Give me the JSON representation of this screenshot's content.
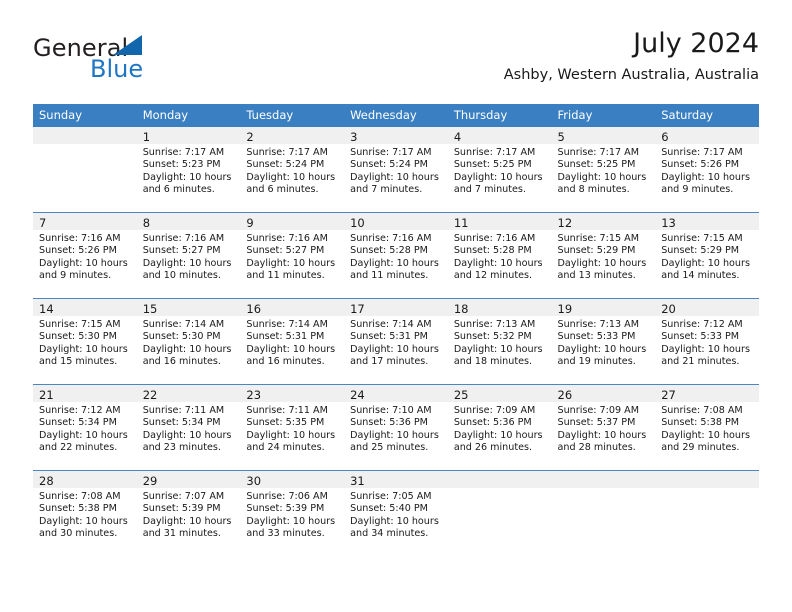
{
  "brand": {
    "name_part1": "General",
    "name_part2": "Blue",
    "logo_icon": "triangle-flag-icon"
  },
  "header": {
    "title": "July 2024",
    "location": "Ashby, Western Australia, Australia"
  },
  "calendar": {
    "weekday_headers": [
      "Sunday",
      "Monday",
      "Tuesday",
      "Wednesday",
      "Thursday",
      "Friday",
      "Saturday"
    ],
    "header_bg_color": "#3a7fc1",
    "daynum_bg_color": "#f0f0f0",
    "row_divider_color": "#4a86c5",
    "weeks": [
      [
        {
          "day": "",
          "sunrise": "",
          "sunset": "",
          "daylight1": "",
          "daylight2": ""
        },
        {
          "day": "1",
          "sunrise": "Sunrise: 7:17 AM",
          "sunset": "Sunset: 5:23 PM",
          "daylight1": "Daylight: 10 hours",
          "daylight2": "and 6 minutes."
        },
        {
          "day": "2",
          "sunrise": "Sunrise: 7:17 AM",
          "sunset": "Sunset: 5:24 PM",
          "daylight1": "Daylight: 10 hours",
          "daylight2": "and 6 minutes."
        },
        {
          "day": "3",
          "sunrise": "Sunrise: 7:17 AM",
          "sunset": "Sunset: 5:24 PM",
          "daylight1": "Daylight: 10 hours",
          "daylight2": "and 7 minutes."
        },
        {
          "day": "4",
          "sunrise": "Sunrise: 7:17 AM",
          "sunset": "Sunset: 5:25 PM",
          "daylight1": "Daylight: 10 hours",
          "daylight2": "and 7 minutes."
        },
        {
          "day": "5",
          "sunrise": "Sunrise: 7:17 AM",
          "sunset": "Sunset: 5:25 PM",
          "daylight1": "Daylight: 10 hours",
          "daylight2": "and 8 minutes."
        },
        {
          "day": "6",
          "sunrise": "Sunrise: 7:17 AM",
          "sunset": "Sunset: 5:26 PM",
          "daylight1": "Daylight: 10 hours",
          "daylight2": "and 9 minutes."
        }
      ],
      [
        {
          "day": "7",
          "sunrise": "Sunrise: 7:16 AM",
          "sunset": "Sunset: 5:26 PM",
          "daylight1": "Daylight: 10 hours",
          "daylight2": "and 9 minutes."
        },
        {
          "day": "8",
          "sunrise": "Sunrise: 7:16 AM",
          "sunset": "Sunset: 5:27 PM",
          "daylight1": "Daylight: 10 hours",
          "daylight2": "and 10 minutes."
        },
        {
          "day": "9",
          "sunrise": "Sunrise: 7:16 AM",
          "sunset": "Sunset: 5:27 PM",
          "daylight1": "Daylight: 10 hours",
          "daylight2": "and 11 minutes."
        },
        {
          "day": "10",
          "sunrise": "Sunrise: 7:16 AM",
          "sunset": "Sunset: 5:28 PM",
          "daylight1": "Daylight: 10 hours",
          "daylight2": "and 11 minutes."
        },
        {
          "day": "11",
          "sunrise": "Sunrise: 7:16 AM",
          "sunset": "Sunset: 5:28 PM",
          "daylight1": "Daylight: 10 hours",
          "daylight2": "and 12 minutes."
        },
        {
          "day": "12",
          "sunrise": "Sunrise: 7:15 AM",
          "sunset": "Sunset: 5:29 PM",
          "daylight1": "Daylight: 10 hours",
          "daylight2": "and 13 minutes."
        },
        {
          "day": "13",
          "sunrise": "Sunrise: 7:15 AM",
          "sunset": "Sunset: 5:29 PM",
          "daylight1": "Daylight: 10 hours",
          "daylight2": "and 14 minutes."
        }
      ],
      [
        {
          "day": "14",
          "sunrise": "Sunrise: 7:15 AM",
          "sunset": "Sunset: 5:30 PM",
          "daylight1": "Daylight: 10 hours",
          "daylight2": "and 15 minutes."
        },
        {
          "day": "15",
          "sunrise": "Sunrise: 7:14 AM",
          "sunset": "Sunset: 5:30 PM",
          "daylight1": "Daylight: 10 hours",
          "daylight2": "and 16 minutes."
        },
        {
          "day": "16",
          "sunrise": "Sunrise: 7:14 AM",
          "sunset": "Sunset: 5:31 PM",
          "daylight1": "Daylight: 10 hours",
          "daylight2": "and 16 minutes."
        },
        {
          "day": "17",
          "sunrise": "Sunrise: 7:14 AM",
          "sunset": "Sunset: 5:31 PM",
          "daylight1": "Daylight: 10 hours",
          "daylight2": "and 17 minutes."
        },
        {
          "day": "18",
          "sunrise": "Sunrise: 7:13 AM",
          "sunset": "Sunset: 5:32 PM",
          "daylight1": "Daylight: 10 hours",
          "daylight2": "and 18 minutes."
        },
        {
          "day": "19",
          "sunrise": "Sunrise: 7:13 AM",
          "sunset": "Sunset: 5:33 PM",
          "daylight1": "Daylight: 10 hours",
          "daylight2": "and 19 minutes."
        },
        {
          "day": "20",
          "sunrise": "Sunrise: 7:12 AM",
          "sunset": "Sunset: 5:33 PM",
          "daylight1": "Daylight: 10 hours",
          "daylight2": "and 21 minutes."
        }
      ],
      [
        {
          "day": "21",
          "sunrise": "Sunrise: 7:12 AM",
          "sunset": "Sunset: 5:34 PM",
          "daylight1": "Daylight: 10 hours",
          "daylight2": "and 22 minutes."
        },
        {
          "day": "22",
          "sunrise": "Sunrise: 7:11 AM",
          "sunset": "Sunset: 5:34 PM",
          "daylight1": "Daylight: 10 hours",
          "daylight2": "and 23 minutes."
        },
        {
          "day": "23",
          "sunrise": "Sunrise: 7:11 AM",
          "sunset": "Sunset: 5:35 PM",
          "daylight1": "Daylight: 10 hours",
          "daylight2": "and 24 minutes."
        },
        {
          "day": "24",
          "sunrise": "Sunrise: 7:10 AM",
          "sunset": "Sunset: 5:36 PM",
          "daylight1": "Daylight: 10 hours",
          "daylight2": "and 25 minutes."
        },
        {
          "day": "25",
          "sunrise": "Sunrise: 7:09 AM",
          "sunset": "Sunset: 5:36 PM",
          "daylight1": "Daylight: 10 hours",
          "daylight2": "and 26 minutes."
        },
        {
          "day": "26",
          "sunrise": "Sunrise: 7:09 AM",
          "sunset": "Sunset: 5:37 PM",
          "daylight1": "Daylight: 10 hours",
          "daylight2": "and 28 minutes."
        },
        {
          "day": "27",
          "sunrise": "Sunrise: 7:08 AM",
          "sunset": "Sunset: 5:38 PM",
          "daylight1": "Daylight: 10 hours",
          "daylight2": "and 29 minutes."
        }
      ],
      [
        {
          "day": "28",
          "sunrise": "Sunrise: 7:08 AM",
          "sunset": "Sunset: 5:38 PM",
          "daylight1": "Daylight: 10 hours",
          "daylight2": "and 30 minutes."
        },
        {
          "day": "29",
          "sunrise": "Sunrise: 7:07 AM",
          "sunset": "Sunset: 5:39 PM",
          "daylight1": "Daylight: 10 hours",
          "daylight2": "and 31 minutes."
        },
        {
          "day": "30",
          "sunrise": "Sunrise: 7:06 AM",
          "sunset": "Sunset: 5:39 PM",
          "daylight1": "Daylight: 10 hours",
          "daylight2": "and 33 minutes."
        },
        {
          "day": "31",
          "sunrise": "Sunrise: 7:05 AM",
          "sunset": "Sunset: 5:40 PM",
          "daylight1": "Daylight: 10 hours",
          "daylight2": "and 34 minutes."
        },
        {
          "day": "",
          "sunrise": "",
          "sunset": "",
          "daylight1": "",
          "daylight2": ""
        },
        {
          "day": "",
          "sunrise": "",
          "sunset": "",
          "daylight1": "",
          "daylight2": ""
        },
        {
          "day": "",
          "sunrise": "",
          "sunset": "",
          "daylight1": "",
          "daylight2": ""
        }
      ]
    ]
  }
}
